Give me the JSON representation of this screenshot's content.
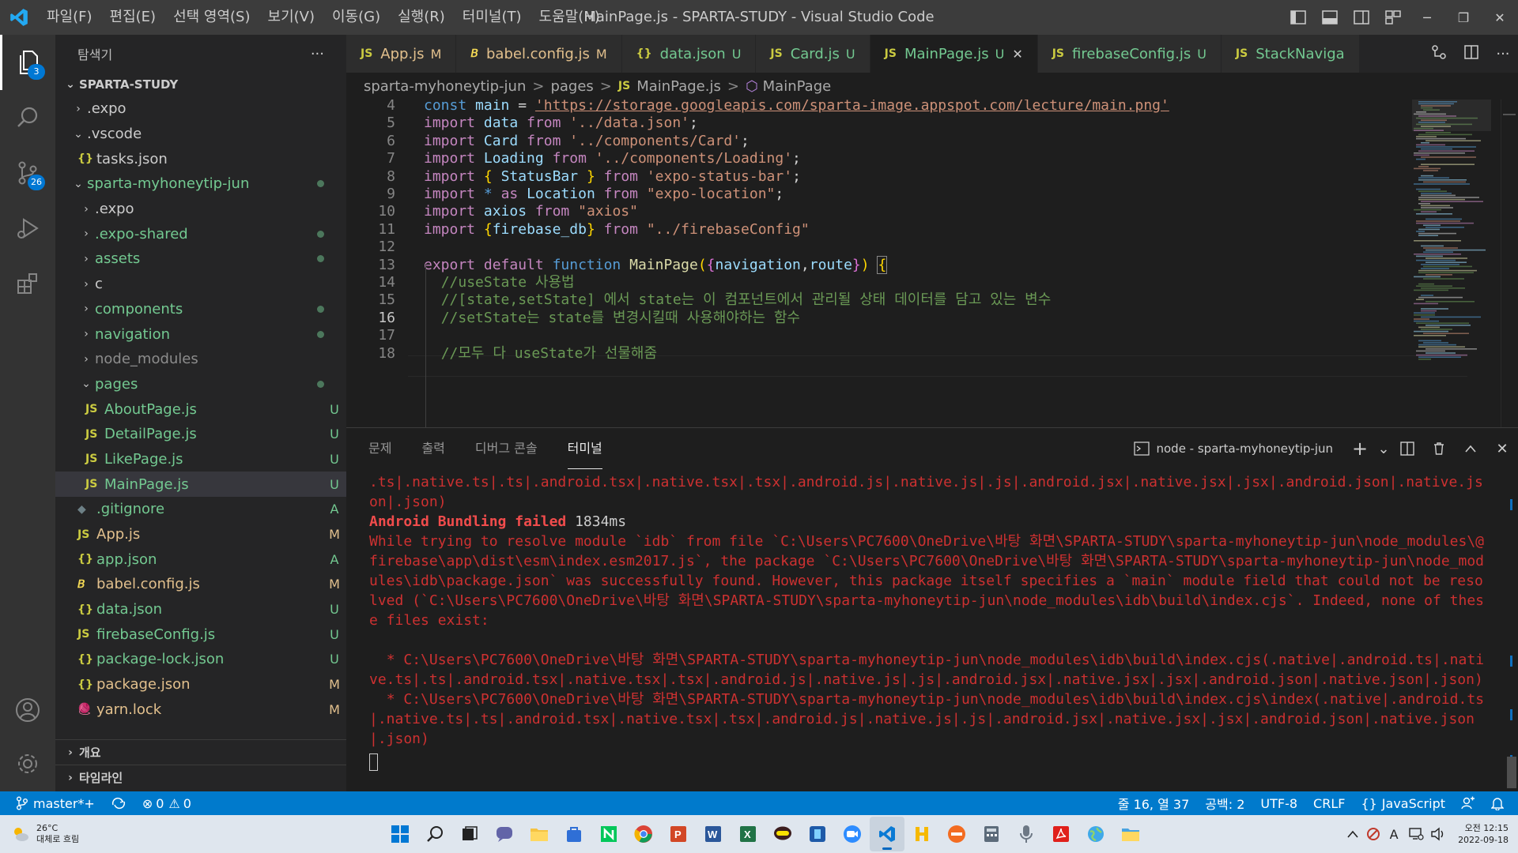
{
  "titlebar": {
    "menu": [
      "파일(F)",
      "편집(E)",
      "선택 영역(S)",
      "보기(V)",
      "이동(G)",
      "실행(R)",
      "터미널(T)",
      "도움말(H)"
    ],
    "title": "MainPage.js - SPARTA-STUDY - Visual Studio Code",
    "window_buttons": {
      "minimize": "─",
      "restore": "❐",
      "close": "✕"
    }
  },
  "activitybar": {
    "explorer_badge": "3",
    "scm_badge": "26"
  },
  "sidebar": {
    "title": "탐색기",
    "more": "···",
    "root": "SPARTA-STUDY",
    "items": [
      {
        "name": ".expo",
        "type": "folder",
        "open": false,
        "depth": 1
      },
      {
        "name": ".vscode",
        "type": "folder",
        "open": true,
        "depth": 1
      },
      {
        "name": "tasks.json",
        "type": "json",
        "depth": 2,
        "icon": "{}"
      },
      {
        "name": "sparta-myhoneytip-jun",
        "type": "folder",
        "open": true,
        "depth": 1,
        "dot": true
      },
      {
        "name": ".expo",
        "type": "folder",
        "open": false,
        "depth": 2
      },
      {
        "name": ".expo-shared",
        "type": "folder",
        "open": false,
        "depth": 2,
        "dot": true
      },
      {
        "name": "assets",
        "type": "folder",
        "open": false,
        "depth": 2,
        "dot": true
      },
      {
        "name": "c",
        "type": "folder",
        "open": false,
        "depth": 2
      },
      {
        "name": "components",
        "type": "folder",
        "open": false,
        "depth": 2,
        "dot": true
      },
      {
        "name": "navigation",
        "type": "folder",
        "open": false,
        "depth": 2,
        "dot": true
      },
      {
        "name": "node_modules",
        "type": "folder",
        "open": false,
        "depth": 2,
        "dim": true
      },
      {
        "name": "pages",
        "type": "folder",
        "open": true,
        "depth": 2,
        "dot": true
      },
      {
        "name": "AboutPage.js",
        "type": "js",
        "depth": 3,
        "status": "U",
        "icon": "JS"
      },
      {
        "name": "DetailPage.js",
        "type": "js",
        "depth": 3,
        "status": "U",
        "icon": "JS"
      },
      {
        "name": "LikePage.js",
        "type": "js",
        "depth": 3,
        "status": "U",
        "icon": "JS"
      },
      {
        "name": "MainPage.js",
        "type": "js",
        "depth": 3,
        "status": "U",
        "icon": "JS",
        "selected": true
      },
      {
        "name": ".gitignore",
        "type": "git",
        "depth": 2,
        "status": "A",
        "icon": "◆"
      },
      {
        "name": "App.js",
        "type": "js",
        "depth": 2,
        "status": "M",
        "icon": "JS"
      },
      {
        "name": "app.json",
        "type": "json",
        "depth": 2,
        "status": "A",
        "icon": "{}"
      },
      {
        "name": "babel.config.js",
        "type": "babel",
        "depth": 2,
        "status": "M",
        "icon": "𝘉"
      },
      {
        "name": "data.json",
        "type": "json",
        "depth": 2,
        "status": "U",
        "icon": "{}"
      },
      {
        "name": "firebaseConfig.js",
        "type": "js",
        "depth": 2,
        "status": "U",
        "icon": "JS"
      },
      {
        "name": "package-lock.json",
        "type": "json",
        "depth": 2,
        "status": "U",
        "icon": "{}"
      },
      {
        "name": "package.json",
        "type": "json",
        "depth": 2,
        "status": "M",
        "icon": "{}"
      },
      {
        "name": "yarn.lock",
        "type": "yarn",
        "depth": 2,
        "status": "M",
        "icon": "🧶"
      }
    ],
    "outline": "개요",
    "timeline": "타임라인"
  },
  "tabs": [
    {
      "icon": "JS",
      "label": "App.js",
      "status": "M",
      "type": "js"
    },
    {
      "icon": "𝘉",
      "label": "babel.config.js",
      "status": "M",
      "type": "babel"
    },
    {
      "icon": "{}",
      "label": "data.json",
      "status": "U",
      "type": "json"
    },
    {
      "icon": "JS",
      "label": "Card.js",
      "status": "U",
      "type": "js"
    },
    {
      "icon": "JS",
      "label": "MainPage.js",
      "status": "U",
      "type": "js",
      "active": true,
      "close": "✕"
    },
    {
      "icon": "JS",
      "label": "firebaseConfig.js",
      "status": "U",
      "type": "js"
    },
    {
      "icon": "JS",
      "label": "StackNaviga",
      "status": "",
      "type": "js"
    }
  ],
  "breadcrumb": {
    "parts": [
      "sparta-myhoneytip-jun",
      "pages",
      "MainPage.js",
      "MainPage"
    ],
    "sep": ">"
  },
  "editor": {
    "current_line": 16,
    "line_numbers": [
      4,
      5,
      6,
      7,
      8,
      9,
      10,
      11,
      12,
      13,
      14,
      15,
      16,
      17,
      18
    ],
    "code": {
      "l4_url": "'https://storage.googleapis.com/sparta-image.appspot.com/lecture/main.png'",
      "l14": "//useState 사용법",
      "l15": "//[state,setState] 에서 state는 이 컴포넌트에서 관리될 상태 데이터를 담고 있는 변수",
      "l16": "//setState는 state를 변경시킬때 사용해야하는 함수",
      "l18": "//모두 다 useState가 선물해줌"
    }
  },
  "panel": {
    "tabs": [
      "문제",
      "출력",
      "디버그 콘솔",
      "터미널"
    ],
    "active_tab": "터미널",
    "terminal_name": "node - sparta-myhoneytip-jun",
    "output": {
      "line1": ".ts|.native.ts|.ts|.android.tsx|.native.tsx|.tsx|.android.js|.native.js|.js|.android.jsx|.native.jsx|.jsx|.android.json|.native.json|.json)",
      "bundling_bold": "Android Bundling failed",
      "bundling_time": " 1834ms",
      "error": "While trying to resolve module `idb` from file `C:\\Users\\PC7600\\OneDrive\\바탕 화면\\SPARTA-STUDY\\sparta-myhoneytip-jun\\node_modules\\@firebase\\app\\dist\\esm\\index.esm2017.js`, the package `C:\\Users\\PC7600\\OneDrive\\바탕 화면\\SPARTA-STUDY\\sparta-myhoneytip-jun\\node_modules\\idb\\package.json` was successfully found. However, this package itself specifies a `main` module field that could not be resolved (`C:\\Users\\PC7600\\OneDrive\\바탕 화면\\SPARTA-STUDY\\sparta-myhoneytip-jun\\node_modules\\idb\\build\\index.cjs`. Indeed, none of these files exist:",
      "item1": "  * C:\\Users\\PC7600\\OneDrive\\바탕 화면\\SPARTA-STUDY\\sparta-myhoneytip-jun\\node_modules\\idb\\build\\index.cjs(.native|.android.ts|.native.ts|.ts|.android.tsx|.native.tsx|.tsx|.android.js|.native.js|.js|.android.jsx|.native.jsx|.jsx|.android.json|.native.json|.json)",
      "item2": "  * C:\\Users\\PC7600\\OneDrive\\바탕 화면\\SPARTA-STUDY\\sparta-myhoneytip-jun\\node_modules\\idb\\build\\index.cjs\\index(.native|.android.ts|.native.ts|.ts|.android.tsx|.native.tsx|.tsx|.android.js|.native.js|.js|.android.jsx|.native.jsx|.jsx|.android.json|.native.json|.json)"
    }
  },
  "statusbar": {
    "branch": "master*+",
    "errors": "0",
    "warnings": "0",
    "position": "줄 16, 열 37",
    "spaces": "공백: 2",
    "encoding": "UTF-8",
    "eol": "CRLF",
    "language": "JavaScript"
  },
  "taskbar": {
    "temperature": "26°C",
    "weather": "대체로 흐림",
    "time": "오전 12:15",
    "date": "2022-09-18",
    "ime": "A"
  },
  "colors": {
    "accent": "#007acc",
    "js_icon": "#cbcb41",
    "json_icon": "#cbcb41",
    "modified": "#e2c08d",
    "untracked": "#73c991",
    "error": "#f14c4c"
  }
}
